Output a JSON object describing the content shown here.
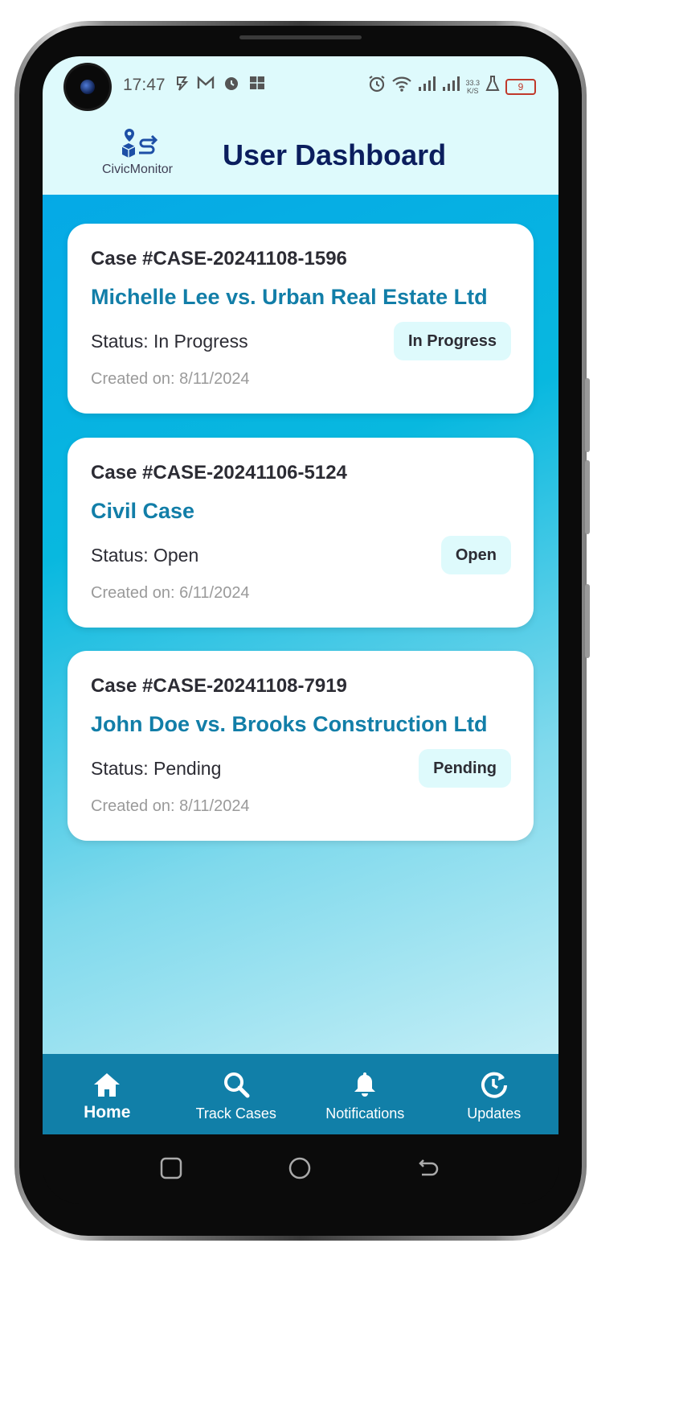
{
  "status_bar": {
    "time": "17:47",
    "left_icons": [
      "sync-icon",
      "mail-icon",
      "alarm-icon",
      "gallery-icon"
    ],
    "right_icons": [
      "alarm-icon",
      "wifi-icon",
      "signal-icon",
      "signal-icon"
    ],
    "speed_value": "33.3",
    "speed_unit": "K/S",
    "battery_level": "9"
  },
  "app": {
    "logo_text": "CivicMonitor",
    "title": "User Dashboard"
  },
  "cases": [
    {
      "case_number": "Case #CASE-20241108-1596",
      "title": "Michelle Lee vs. Urban Real Estate Ltd",
      "status_line": "Status: In Progress",
      "badge": "In Progress",
      "created": "Created on: 8/11/2024"
    },
    {
      "case_number": "Case #CASE-20241106-5124",
      "title": "Civil Case",
      "status_line": "Status: Open",
      "badge": "Open",
      "created": "Created on: 6/11/2024"
    },
    {
      "case_number": "Case #CASE-20241108-7919",
      "title": "John Doe vs. Brooks Construction Ltd",
      "status_line": "Status: Pending",
      "badge": "Pending",
      "created": "Created on: 8/11/2024"
    }
  ],
  "bottom_nav": [
    {
      "label": "Home",
      "icon": "home-icon",
      "active": true
    },
    {
      "label": "Track Cases",
      "icon": "search-icon",
      "active": false
    },
    {
      "label": "Notifications",
      "icon": "bell-icon",
      "active": false
    },
    {
      "label": "Updates",
      "icon": "refresh-clock-icon",
      "active": false
    }
  ],
  "colors": {
    "status_bar_bg": "#defafc",
    "title_color": "#0b1e5e",
    "case_title_color": "#127ea8",
    "nav_bg": "#117fa8",
    "badge_bg": "#defafc"
  }
}
